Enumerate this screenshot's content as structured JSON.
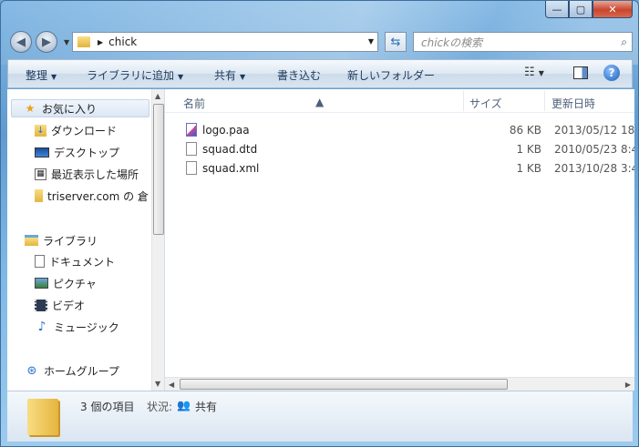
{
  "window": {
    "minimize": "—",
    "maximize": "▢",
    "close": "✕"
  },
  "address": {
    "path": "chick"
  },
  "search": {
    "placeholder": "chickの検索"
  },
  "toolbar": {
    "organize": "整理",
    "add_to_library": "ライブラリに追加",
    "share": "共有",
    "burn": "書き込む",
    "new_folder": "新しいフォルダー"
  },
  "sidebar": {
    "favorites": "お気に入り",
    "items": [
      {
        "label": "ダウンロード",
        "icon": "download-folder-icon"
      },
      {
        "label": "デスクトップ",
        "icon": "desktop-icon"
      },
      {
        "label": "最近表示した場所",
        "icon": "recent-places-icon"
      },
      {
        "label": "triserver.com の 倉",
        "icon": "folder-icon"
      }
    ],
    "libraries": "ライブラリ",
    "library_items": [
      {
        "label": "ドキュメント",
        "icon": "document-icon"
      },
      {
        "label": "ピクチャ",
        "icon": "picture-icon"
      },
      {
        "label": "ビデオ",
        "icon": "video-icon"
      },
      {
        "label": "ミュージック",
        "icon": "music-icon"
      }
    ],
    "homegroup": "ホームグループ"
  },
  "columns": {
    "name": "名前",
    "size": "サイズ",
    "modified": "更新日時"
  },
  "files": [
    {
      "name": "logo.paa",
      "size": "86 KB",
      "modified": "2013/05/12 18:"
    },
    {
      "name": "squad.dtd",
      "size": "1 KB",
      "modified": "2010/05/23 8:4"
    },
    {
      "name": "squad.xml",
      "size": "1 KB",
      "modified": "2013/10/28 3:4"
    }
  ],
  "status": {
    "count": "3 個の項目",
    "state_label": "状況:",
    "state_value": "共有"
  }
}
